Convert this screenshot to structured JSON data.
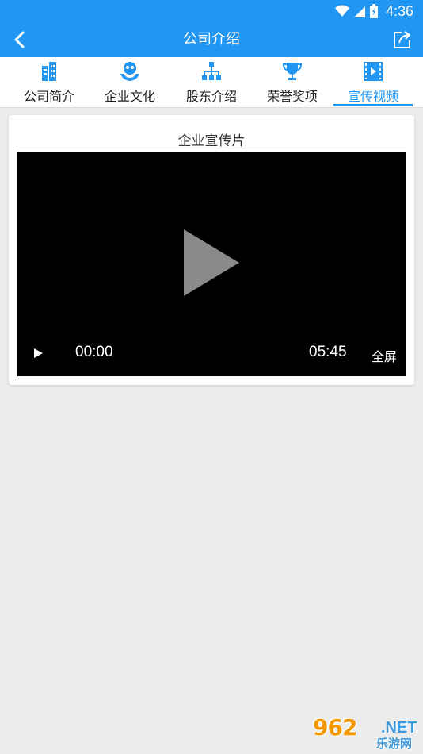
{
  "status_bar": {
    "time": "4:36"
  },
  "app_bar": {
    "title": "公司介绍"
  },
  "tabs": [
    {
      "label": "公司简介",
      "icon": "building-icon",
      "active": false
    },
    {
      "label": "企业文化",
      "icon": "culture-icon",
      "active": false
    },
    {
      "label": "股东介绍",
      "icon": "org-chart-icon",
      "active": false
    },
    {
      "label": "荣誉奖项",
      "icon": "trophy-icon",
      "active": false
    },
    {
      "label": "宣传视频",
      "icon": "film-icon",
      "active": true
    }
  ],
  "video_card": {
    "title": "企业宣传片",
    "current_time": "00:00",
    "duration": "05:45",
    "fullscreen_label": "全屏"
  },
  "watermark": {
    "main": "962",
    "net": ".NET",
    "sub": "乐游网"
  },
  "colors": {
    "primary": "#2196f3",
    "background": "#ececec",
    "video_bg": "#000000"
  }
}
